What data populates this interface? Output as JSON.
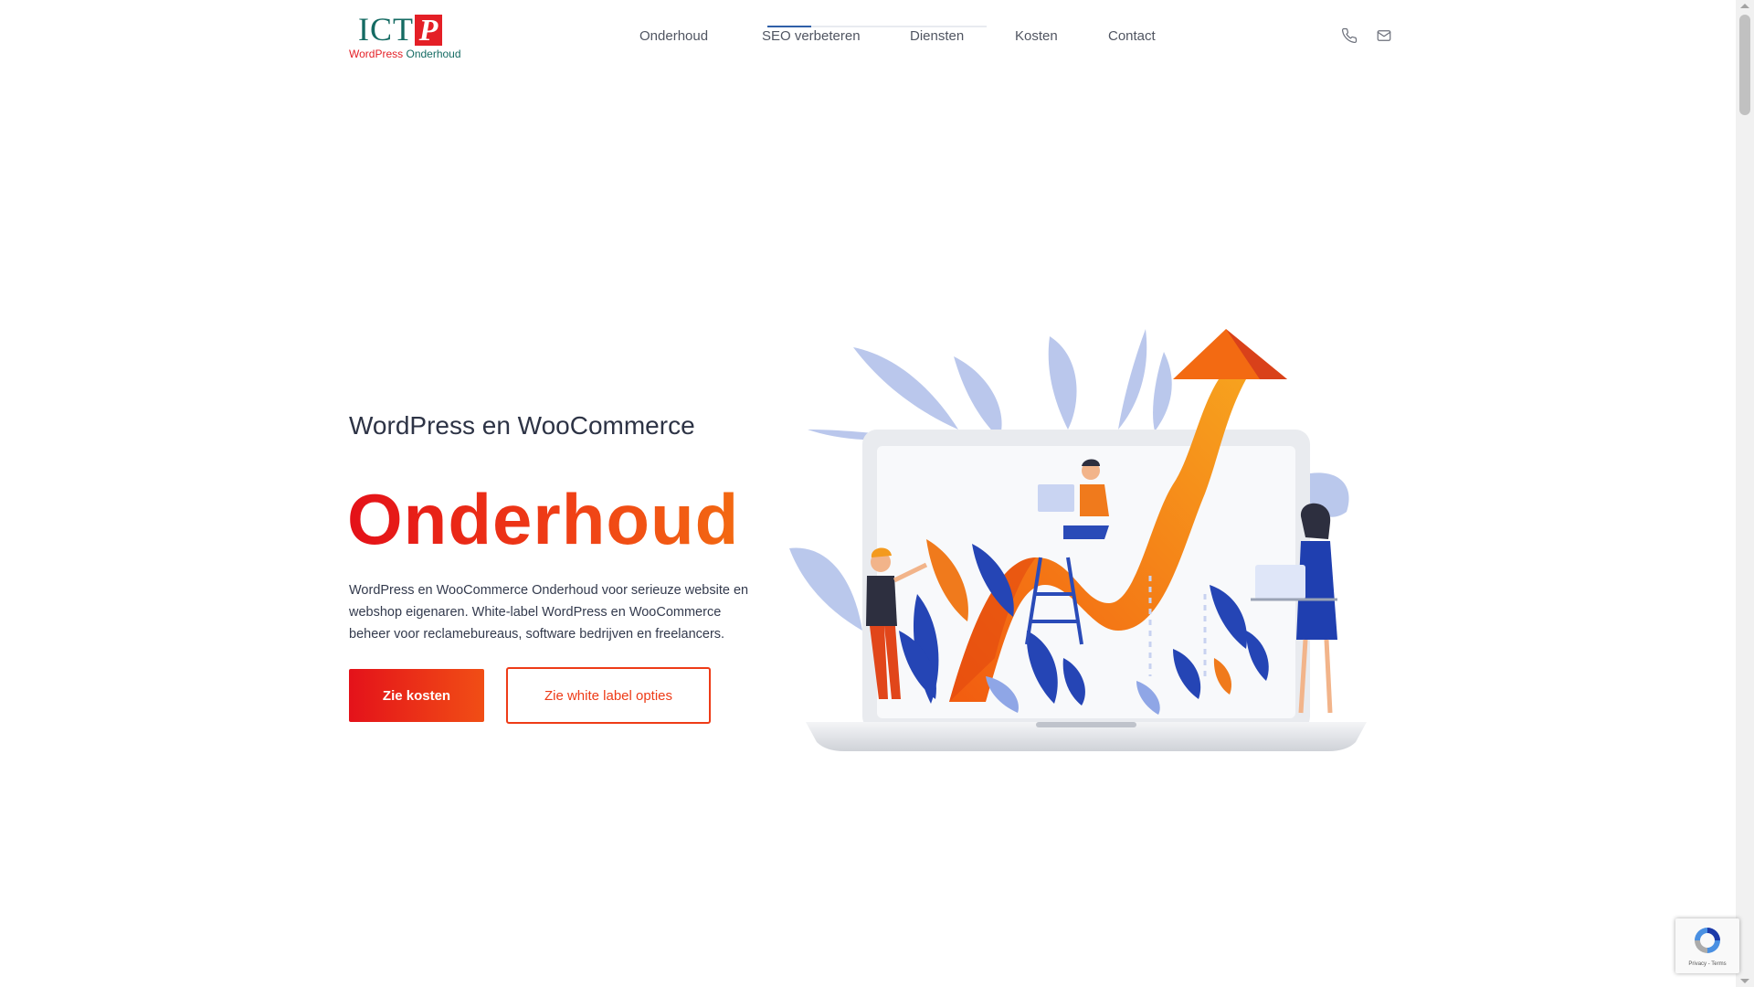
{
  "logo": {
    "mark_ict": "ICT",
    "mark_p": "P",
    "sub_wordpress": "WordPress",
    "sub_onderhoud": "Onderhoud",
    "colors": {
      "red": "#e41f26",
      "green": "#156b63"
    }
  },
  "nav": {
    "items": [
      {
        "label": "Onderhoud"
      },
      {
        "label": "SEO verbeteren"
      },
      {
        "label": "Diensten"
      },
      {
        "label": "Kosten"
      },
      {
        "label": "Contact"
      }
    ],
    "active_index": 1
  },
  "header_icons": [
    "phone-icon",
    "mail-icon"
  ],
  "hero": {
    "pretitle": "WordPress en WooCommerce",
    "title": "Onderhoud",
    "description": "WordPress en WooCommerce Onderhoud voor serieuze website en webshop eigenaren. White-label WordPress en WooCommerce beheer voor reclamebureaus, software bedrijven en freelancers.",
    "primary_button": "Zie kosten",
    "secondary_button": "Zie white label opties"
  },
  "recaptcha": {
    "text": "Privacy - Terms"
  },
  "colors": {
    "accent": "#ee3b17",
    "accent_gradient_start": "#e4121a",
    "accent_gradient_end": "#f36a12",
    "text_dark": "#2d3345",
    "nav_text": "#505561",
    "illustration_blue": "#2a4bb8",
    "illustration_light_blue": "#a9b9e8"
  }
}
